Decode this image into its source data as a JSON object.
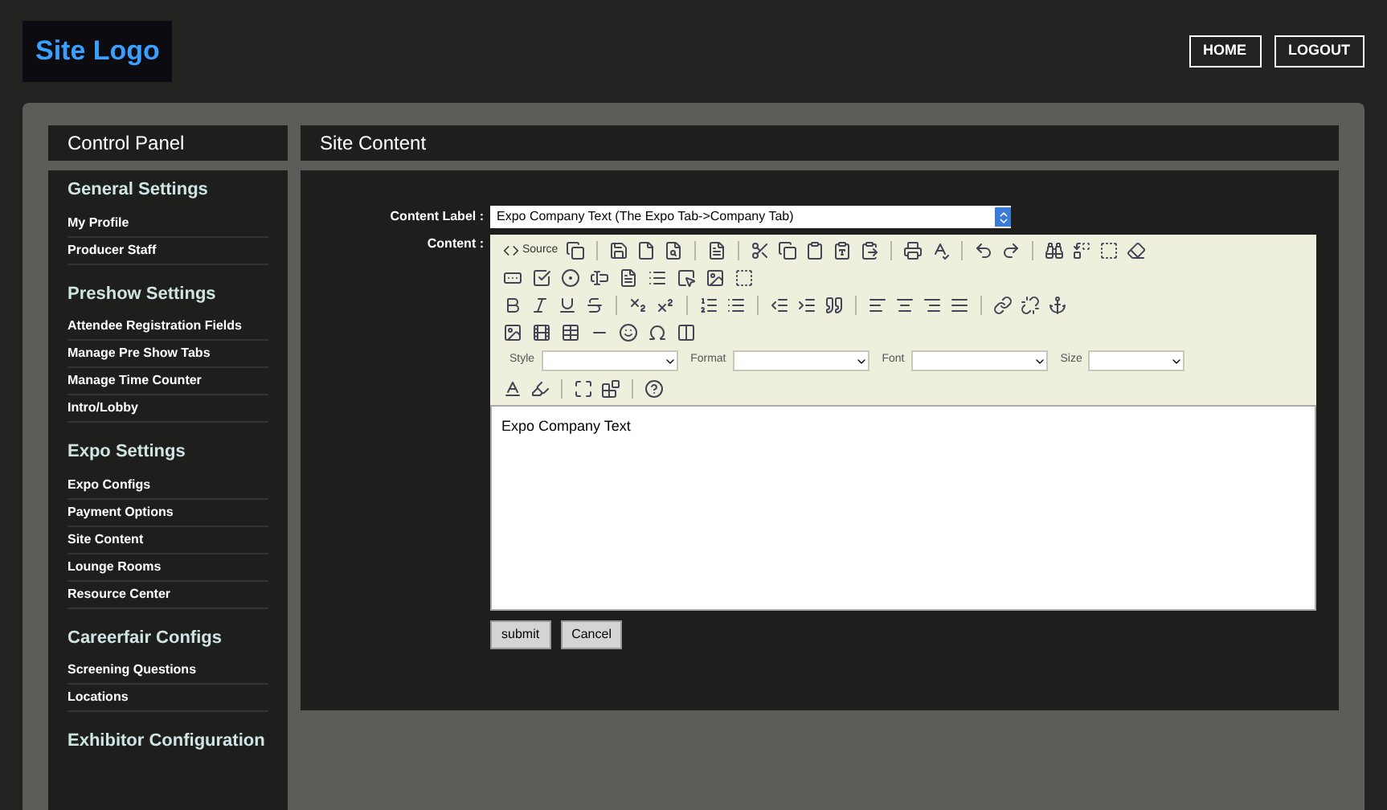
{
  "header": {
    "logo": "Site Logo",
    "nav": [
      "HOME",
      "LOGOUT"
    ]
  },
  "sidebar": {
    "title": "Control Panel",
    "sections": [
      {
        "heading": "General Settings",
        "items": [
          "My Profile",
          "Producer Staff"
        ]
      },
      {
        "heading": "Preshow Settings",
        "items": [
          "Attendee Registration Fields",
          "Manage Pre Show Tabs",
          "Manage Time Counter",
          "Intro/Lobby"
        ]
      },
      {
        "heading": "Expo Settings",
        "items": [
          "Expo Configs",
          "Payment Options",
          "Site Content",
          "Lounge Rooms",
          "Resource Center"
        ]
      },
      {
        "heading": "Careerfair Configs",
        "items": [
          "Screening Questions",
          "Locations"
        ]
      },
      {
        "heading": "Exhibitor Configuration"
      }
    ]
  },
  "main": {
    "title": "Site Content",
    "content_label": {
      "label": "Content Label :",
      "value": "Expo Company Text (The Expo Tab->Company Tab)"
    },
    "content": {
      "label": "Content :",
      "source_label": "Source",
      "combos": [
        "Style",
        "Format",
        "Font",
        "Size"
      ],
      "text": "Expo Company Text"
    },
    "buttons": [
      "submit",
      "Cancel"
    ]
  }
}
